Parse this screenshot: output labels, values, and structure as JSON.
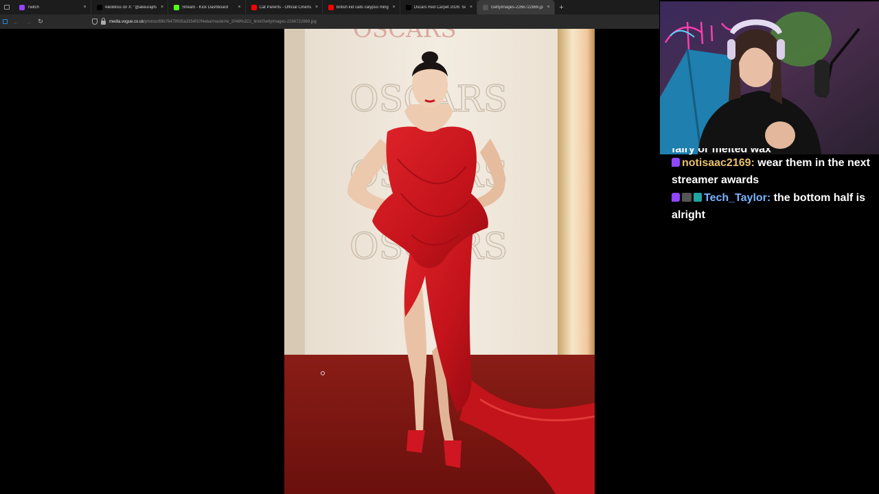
{
  "tabs": [
    {
      "title": "Twitch",
      "favicon_color": "#9146ff",
      "active": false
    },
    {
      "title": "AikoBliss on X: \"@akeurajitsuk",
      "favicon_color": "#000000",
      "active": false
    },
    {
      "title": "Stream - Kick Dashboard",
      "favicon_color": "#53fc18",
      "active": false
    },
    {
      "title": "Cat Parents - Official Cinematic",
      "favicon_color": "#ff0000",
      "active": false
    },
    {
      "title": "british kid calls calypso mingin",
      "favicon_color": "#ff0000",
      "active": false
    },
    {
      "title": "Oscars Red Carpet 2026: See E",
      "favicon_color": "#000000",
      "active": false
    },
    {
      "title": "GettyImages-2266722869.jpg (WE",
      "favicon_color": "#555555",
      "active": true
    }
  ],
  "new_tab_label": "+",
  "tab_close_glyph": "×",
  "nav": {
    "back": "←",
    "forward": "→",
    "reload": "↻"
  },
  "url": {
    "domain": "media.vogue.co.uk",
    "path": "/photos/69b76479935a3354f10f4eba/master/w_2048%2Cc_limit/GettyImages-2266722869.jpg"
  },
  "photo": {
    "backdrop_text": "OSCARS",
    "top_backdrop_text": "OSCARS"
  },
  "chat": {
    "cut_off_line": "fairy or melted wax",
    "messages": [
      {
        "username": "notisaac2169",
        "username_color": "#e8c06b",
        "badges": [
          "twitch"
        ],
        "text": "wear them in the next streamer awards"
      },
      {
        "username": "Tech_Taylor",
        "username_color": "#7ab3ff",
        "badges": [
          "twitch",
          "cam",
          "verified"
        ],
        "text": "the bottom half is alright"
      }
    ]
  },
  "colors": {
    "accent_twitch": "#9146ff",
    "carpet": "#7a1410",
    "gown": "#c8141c"
  }
}
